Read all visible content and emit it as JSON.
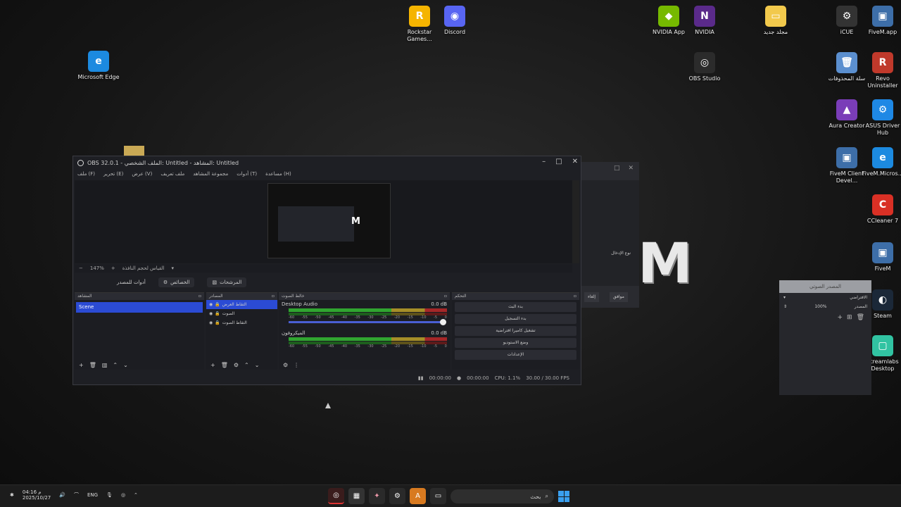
{
  "desktop_icons": [
    {
      "label": "Microsoft Edge",
      "icon": "edge-icon",
      "color": "#1c8ae0",
      "glyph": "e"
    },
    {
      "label": "Rockstar Games...",
      "icon": "rockstar-icon",
      "color": "#f5b400",
      "glyph": "R"
    },
    {
      "label": "Discord",
      "icon": "discord-icon",
      "color": "#5865f2",
      "glyph": "◉"
    },
    {
      "label": "NVIDIA App",
      "icon": "nvidia-icon",
      "color": "#76b900",
      "glyph": "◆"
    },
    {
      "label": "NVIDIA",
      "icon": "nvidia-broadcast-icon",
      "color": "#5a2a8a",
      "glyph": "N"
    },
    {
      "label": "OBS Studio",
      "icon": "obs-icon",
      "color": "#2b2b2b",
      "glyph": "◎"
    },
    {
      "label": "مجلد جديد",
      "icon": "folder-icon",
      "color": "#f2c94c",
      "glyph": "▭"
    },
    {
      "label": "iCUE",
      "icon": "icue-icon",
      "color": "#333333",
      "glyph": "⚙"
    },
    {
      "label": "FiveM.app",
      "icon": "fivem-app-icon",
      "color": "#3d6ea8",
      "glyph": "▣"
    },
    {
      "label": "سلة المحذوفات",
      "icon": "recycle-bin-icon",
      "color": "#5b8fcf",
      "glyph": "🗑"
    },
    {
      "label": "Revo Uninstaller",
      "icon": "revo-icon",
      "color": "#c0392b",
      "glyph": "R"
    },
    {
      "label": "Aura Creator",
      "icon": "aura-creator-icon",
      "color": "#7a3db8",
      "glyph": "▲"
    },
    {
      "label": "ASUS Driver Hub",
      "icon": "asus-driver-icon",
      "color": "#1e88e5",
      "glyph": "⚙"
    },
    {
      "label": "FiveM Client Devel...",
      "icon": "fivem-dev-icon",
      "color": "#3d6ea8",
      "glyph": "▣"
    },
    {
      "label": "FiveM.Micros...",
      "icon": "edge-fivem-icon",
      "color": "#1c8ae0",
      "glyph": "e"
    },
    {
      "label": "CCleaner 7",
      "icon": "ccleaner-icon",
      "color": "#d93025",
      "glyph": "C"
    },
    {
      "label": "FiveM",
      "icon": "fivem-icon",
      "color": "#3d6ea8",
      "glyph": "▣"
    },
    {
      "label": "Steam",
      "icon": "steam-icon",
      "color": "#1b2838",
      "glyph": "◐"
    },
    {
      "label": "Streamlabs Desktop",
      "icon": "streamlabs-icon",
      "color": "#31c3a2",
      "glyph": "▢"
    }
  ],
  "obs": {
    "title": "OBS 32.0.1 - الملف الشخصي: Untitled - المشاهد: Untitled",
    "menu": [
      "ملف (F)",
      "تحرير (E)",
      "عرض (V)",
      "ملف تعريف",
      "مجموعة المشاهد",
      "أدوات (T)",
      "مساعدة (H)"
    ],
    "zoom_label": "147%",
    "fit_label": "القياس لحجم النافذة",
    "controls": [
      "الخصائص",
      "المرشحات"
    ],
    "studio_mode_label": "أدوات للمصدر",
    "docks": {
      "scenes": "المشاهد",
      "sources": "المصادر",
      "mixer": "خالط الصوت",
      "controls": "التحكم"
    },
    "scene_item": "Scene",
    "sources_list": [
      "التقاط العرض",
      "الصوت",
      "التقاط الصوت"
    ],
    "mixer_channels": [
      {
        "name": "Desktop Audio",
        "db": "0.0 dB"
      },
      {
        "name": "الميكروفون",
        "db": "0.0 dB"
      }
    ],
    "meter_ticks": [
      "-60",
      "-55",
      "-50",
      "-45",
      "-40",
      "-35",
      "-30",
      "-25",
      "-20",
      "-15",
      "-10",
      "-5",
      "0"
    ],
    "control_buttons": [
      "بدء البث",
      "بدء التسجيل",
      "تشغيل كاميرا افتراضية",
      "وضع الاستوديو",
      "الإعدادات"
    ],
    "status": {
      "rec_time": "00:00:00",
      "stream_time": "00:00:00",
      "cpu": "CPU: 1.1%",
      "fps": "30.00 / 30.00 FPS"
    }
  },
  "bg_dialog": {
    "label": "نوع الإدخال",
    "ok": "موافق",
    "cancel": "إلغاء"
  },
  "side_panel": {
    "header": "المصدر الصوتي",
    "row1": "الافتراضي",
    "row2_label": "المصدر",
    "row2_value": "100%"
  },
  "taskbar": {
    "time": "م 04:16",
    "date": "2025/10/27",
    "lang": "ENG",
    "search_placeholder": "بحث"
  },
  "accent": "#2b4bd4"
}
